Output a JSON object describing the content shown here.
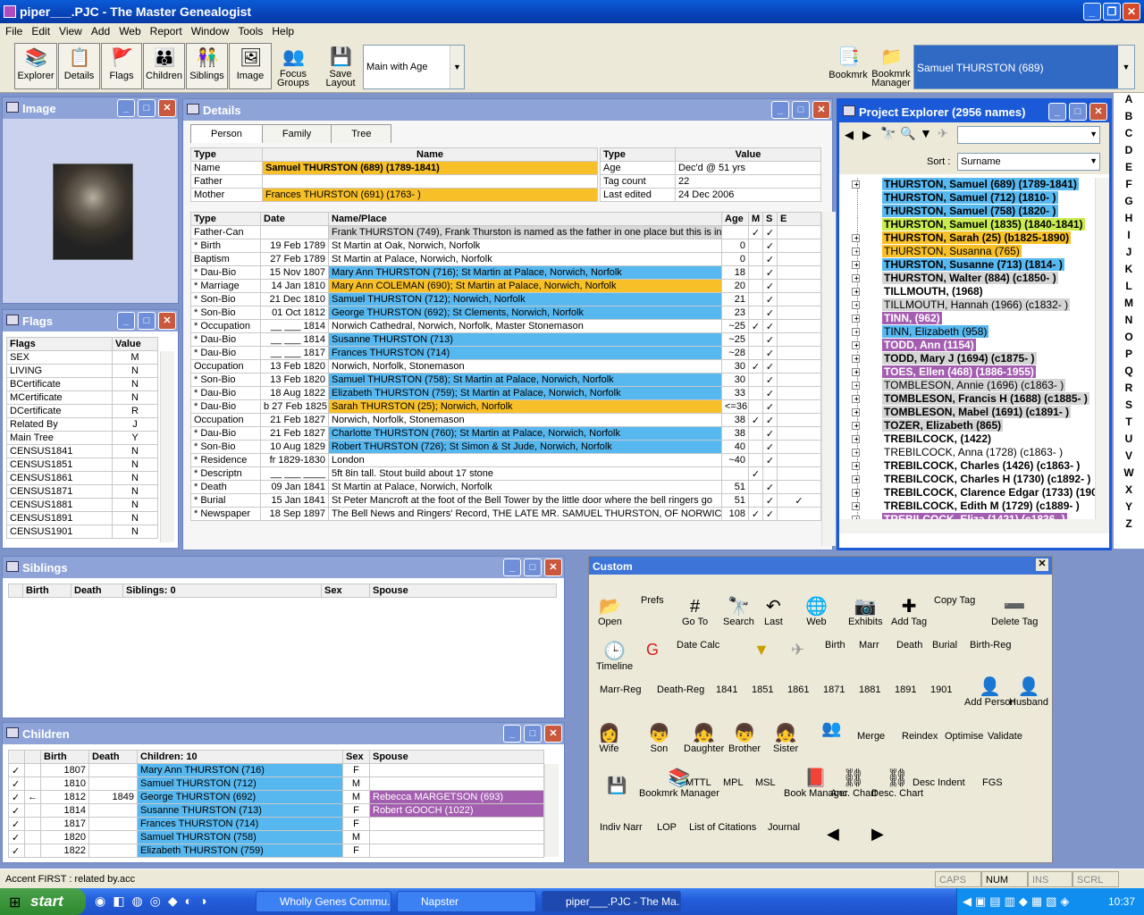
{
  "app": {
    "title": "piper___.PJC - The Master Genealogist"
  },
  "menu": [
    "File",
    "Edit",
    "View",
    "Add",
    "Web",
    "Report",
    "Window",
    "Tools",
    "Help"
  ],
  "toolbar": {
    "buttons": [
      "Explorer",
      "Details",
      "Flags",
      "Children",
      "Siblings",
      "Image"
    ],
    "focus_groups": "Focus Groups",
    "save_layout": "Save Layout",
    "layout_select": "Main with Age",
    "bookmrk": "Bookmrk",
    "bookmrk_manager": "Bookmrk Manager",
    "current_person": "Samuel THURSTON (689)"
  },
  "image_pane": {
    "title": "Image"
  },
  "flags_pane": {
    "title": "Flags",
    "headers": [
      "Flags",
      "Value"
    ],
    "rows": [
      [
        "SEX",
        "M"
      ],
      [
        "LIVING",
        "N"
      ],
      [
        "BCertificate",
        "N"
      ],
      [
        "MCertificate",
        "N"
      ],
      [
        "DCertificate",
        "R"
      ],
      [
        "Related By",
        "J"
      ],
      [
        "Main Tree",
        "Y"
      ],
      [
        "CENSUS1841",
        "N"
      ],
      [
        "CENSUS1851",
        "N"
      ],
      [
        "CENSUS1861",
        "N"
      ],
      [
        "CENSUS1871",
        "N"
      ],
      [
        "CENSUS1881",
        "N"
      ],
      [
        "CENSUS1891",
        "N"
      ],
      [
        "CENSUS1901",
        "N"
      ]
    ]
  },
  "details_pane": {
    "title": "Details",
    "tabs": [
      "Person",
      "Family",
      "Tree"
    ],
    "name_headers": [
      "Type",
      "Name"
    ],
    "name_rows": [
      [
        "Name",
        "Samuel THURSTON (689)  (1789-1841)",
        "co"
      ],
      [
        "Father",
        "",
        ""
      ],
      [
        "Mother",
        "Frances THURSTON (691)  (1763-   )",
        "co"
      ]
    ],
    "info_headers": [
      "Type",
      "Value"
    ],
    "info_rows": [
      [
        "Age",
        "Dec'd @ 51 yrs"
      ],
      [
        "Tag count",
        "22"
      ],
      [
        "Last edited",
        "24 Dec 2006"
      ]
    ],
    "event_headers": [
      "Type",
      "Date",
      "Name/Place",
      "Age",
      "M",
      "S",
      "E"
    ],
    "events": [
      [
        "  Father-Can",
        "",
        "Frank THURSTON (749), Frank Thurston is named as the father in one place but this is in",
        "",
        "✓",
        "✓",
        "",
        "cg"
      ],
      [
        "* Birth",
        "19 Feb 1789",
        "St Martin at Oak, Norwich, Norfolk",
        "0",
        "",
        "✓",
        "",
        ""
      ],
      [
        "  Baptism",
        "27 Feb 1789",
        "St Martin at Palace, Norwich, Norfolk",
        "0",
        "",
        "✓",
        "",
        ""
      ],
      [
        "* Dau-Bio",
        "15 Nov 1807",
        "Mary Ann THURSTON (716); St Martin at Palace, Norwich, Norfolk",
        "18",
        "",
        "✓",
        "",
        "cy"
      ],
      [
        "* Marriage",
        "14 Jan 1810",
        "Mary Ann COLEMAN (690); St Martin at Palace, Norwich, Norfolk",
        "20",
        "",
        "✓",
        "",
        "co"
      ],
      [
        "* Son-Bio",
        "21 Dec 1810",
        "Samuel THURSTON (712); Norwich, Norfolk",
        "21",
        "",
        "✓",
        "",
        "cy"
      ],
      [
        "* Son-Bio",
        "01 Oct 1812",
        "George THURSTON (692); St Clements, Norwich, Norfolk",
        "23",
        "",
        "✓",
        "",
        "cy"
      ],
      [
        "* Occupation",
        "__ ___ 1814",
        "Norwich Cathedral, Norwich, Norfolk, Master Stonemason",
        "~25",
        "✓",
        "✓",
        "",
        ""
      ],
      [
        "* Dau-Bio",
        "__ ___ 1814",
        "Susanne THURSTON (713)",
        "~25",
        "",
        "✓",
        "",
        "cy"
      ],
      [
        "* Dau-Bio",
        "__ ___ 1817",
        "Frances THURSTON (714)",
        "~28",
        "",
        "✓",
        "",
        "cy"
      ],
      [
        "  Occupation",
        "13 Feb 1820",
        "Norwich, Norfolk, Stonemason",
        "30",
        "✓",
        "✓",
        "",
        ""
      ],
      [
        "* Son-Bio",
        "13 Feb 1820",
        "Samuel THURSTON (758); St Martin at Palace, Norwich, Norfolk",
        "30",
        "",
        "✓",
        "",
        "cy"
      ],
      [
        "* Dau-Bio",
        "18 Aug 1822",
        "Elizabeth THURSTON (759); St Martin at Palace, Norwich, Norfolk",
        "33",
        "",
        "✓",
        "",
        "cy"
      ],
      [
        "* Dau-Bio",
        "b 27 Feb 1825",
        "Sarah THURSTON (25); Norwich, Norfolk",
        "<=36",
        "",
        "✓",
        "",
        "co"
      ],
      [
        "  Occupation",
        "21 Feb 1827",
        "Norwich, Norfolk, Stonemason",
        "38",
        "✓",
        "✓",
        "",
        ""
      ],
      [
        "* Dau-Bio",
        "21 Feb 1827",
        "Charlotte THURSTON (760); St Martin at Palace, Norwich, Norfolk",
        "38",
        "",
        "✓",
        "",
        "cy"
      ],
      [
        "* Son-Bio",
        "10 Aug 1829",
        "Robert THURSTON (726); St Simon & St Jude, Norwich, Norfolk",
        "40",
        "",
        "✓",
        "",
        "cy"
      ],
      [
        "* Residence",
        "fr 1829-1830",
        "London",
        "~40",
        "",
        "✓",
        "",
        ""
      ],
      [
        "* Descriptn",
        "__ ___ ____",
        "5ft 8in tall. Stout build about 17 stone",
        "",
        "✓",
        "",
        "",
        ""
      ],
      [
        "* Death",
        "09 Jan 1841",
        "St Martin at Palace, Norwich, Norfolk",
        "51",
        "",
        "✓",
        "",
        ""
      ],
      [
        "* Burial",
        "15 Jan 1841",
        "St Peter Mancroft at the foot of the Bell Tower by the little door where the bell ringers go",
        "51",
        "",
        "✓",
        "✓",
        ""
      ],
      [
        "* Newspaper",
        "18 Sep 1897",
        "The Bell News and Ringers' Record, THE LATE MR. SAMUEL THURSTON, OF NORWICH.",
        "108",
        "✓",
        "✓",
        "",
        ""
      ]
    ]
  },
  "explorer": {
    "title": "Project Explorer (2956 names)",
    "sort_label": "Sort :",
    "sort_value": "Surname",
    "rows": [
      [
        "THURSTON, Samuel (689) (1789-1841)",
        "cy",
        1
      ],
      [
        "THURSTON, Samuel (712) (1810-   )",
        "cy",
        0
      ],
      [
        "THURSTON, Samuel (758) (1820-   )",
        "cy",
        0
      ],
      [
        "THURSTON, Samuel (1835) (1840-1841)",
        "cyl",
        0
      ],
      [
        "THURSTON, Sarah (25) (b1825-1890)",
        "co",
        1
      ],
      [
        "THURSTON, Susanna (765)",
        "con",
        1
      ],
      [
        "THURSTON, Susanne (713) (1814-   )",
        "cy",
        1
      ],
      [
        "THURSTON, Walter (884) (c1850-   )",
        "cg",
        1
      ],
      [
        "TILLMOUTH, (1968)",
        "",
        1
      ],
      [
        "TILLMOUTH, Hannah (1966) (c1832-   )",
        "cgn",
        1
      ],
      [
        "TINN, (962)",
        "cp",
        1
      ],
      [
        "TINN, Elizabeth (958)",
        "cyn",
        1
      ],
      [
        "TODD, Ann (1154)",
        "cp",
        1
      ],
      [
        "TODD, Mary J (1694) (c1875-   )",
        "cg",
        1
      ],
      [
        "TOES, Ellen (468) (1886-1955)",
        "cp",
        1
      ],
      [
        "TOMBLESON, Annie (1696) (c1863-   )",
        "cgn",
        1
      ],
      [
        "TOMBLESON, Francis H (1688) (c1885-   )",
        "cg",
        1
      ],
      [
        "TOMBLESON, Mabel (1691) (c1891-   )",
        "cg",
        1
      ],
      [
        "TOZER, Elizabeth (865)",
        "cg",
        1
      ],
      [
        "TREBILCOCK, (1422)",
        "",
        1
      ],
      [
        "TREBILCOCK, Anna (1728) (c1863-   )",
        "n",
        1
      ],
      [
        "TREBILCOCK, Charles (1426) (c1863-   )",
        "",
        1
      ],
      [
        "TREBILCOCK, Charles H (1730) (c1892-   )",
        "",
        1
      ],
      [
        "TREBILCOCK, Clarence Edgar (1733) (190",
        "",
        1
      ],
      [
        "TREBILCOCK, Edith M (1729) (c1889-   )",
        "",
        1
      ],
      [
        "TREBILCOCK, Eliza (1421) (c1836-   )",
        "cp",
        1
      ]
    ]
  },
  "alphabet": [
    "A",
    "B",
    "C",
    "D",
    "E",
    "F",
    "G",
    "H",
    "I",
    "J",
    "K",
    "L",
    "M",
    "N",
    "O",
    "P",
    "Q",
    "R",
    "S",
    "T",
    "U",
    "V",
    "W",
    "X",
    "Y",
    "Z"
  ],
  "siblings_pane": {
    "title": "Siblings",
    "headers": [
      "Birth",
      "Death",
      "Siblings: 0",
      "Sex",
      "Spouse"
    ]
  },
  "children_pane": {
    "title": "Children",
    "headers": [
      "Birth",
      "Death",
      "Children: 10",
      "Sex",
      "Spouse"
    ],
    "rows": [
      [
        "✓",
        "",
        "1807",
        "",
        "Mary Ann THURSTON (716)",
        "F",
        ""
      ],
      [
        "✓",
        "",
        "1810",
        "",
        "Samuel THURSTON (712)",
        "M",
        ""
      ],
      [
        "✓",
        "←",
        "1812",
        "1849",
        "George THURSTON (692)",
        "M",
        "Rebecca MARGETSON (693)"
      ],
      [
        "✓",
        "",
        "1814",
        "",
        "Susanne THURSTON (713)",
        "F",
        "Robert GOOCH (1022)"
      ],
      [
        "✓",
        "",
        "1817",
        "",
        "Frances THURSTON (714)",
        "F",
        ""
      ],
      [
        "✓",
        "",
        "1820",
        "",
        "Samuel THURSTON (758)",
        "M",
        ""
      ],
      [
        "✓",
        "",
        "1822",
        "",
        "Elizabeth THURSTON (759)",
        "F",
        ""
      ]
    ]
  },
  "custom": {
    "title": "Custom",
    "items": [
      "Open",
      "Prefs",
      "Go To",
      "Search",
      "Last",
      "Web",
      "Exhibits",
      "Add Tag",
      "Copy Tag",
      "Delete Tag",
      "Timeline",
      "Date Calc",
      "Birth",
      "Marr",
      "Death",
      "Burial",
      "Birth-Reg",
      "Marr-Reg",
      "Death-Reg",
      "1841",
      "1851",
      "1861",
      "1871",
      "1881",
      "1891",
      "1901",
      "Add Person",
      "Husband",
      "Wife",
      "Son",
      "Daughter",
      "Brother",
      "Sister",
      "Merge",
      "Reindex",
      "Optimise",
      "Validate",
      "Bookmrk Manager",
      "MTTL",
      "MPL",
      "MSL",
      "Book Manager",
      "Anc. Chart",
      "Desc. Chart",
      "Desc Indent",
      "FGS",
      "Indiv Narr",
      "LOP",
      "List of Citations",
      "Journal"
    ]
  },
  "status": {
    "text": "Accent FIRST : related by.acc",
    "caps": "CAPS",
    "num": "NUM",
    "ins": "INS",
    "scrl": "SCRL"
  },
  "taskbar": {
    "start": "start",
    "tasks": [
      "Wholly Genes Commu...",
      "Napster",
      "piper___.PJC - The Ma..."
    ],
    "clock": "10:37"
  }
}
